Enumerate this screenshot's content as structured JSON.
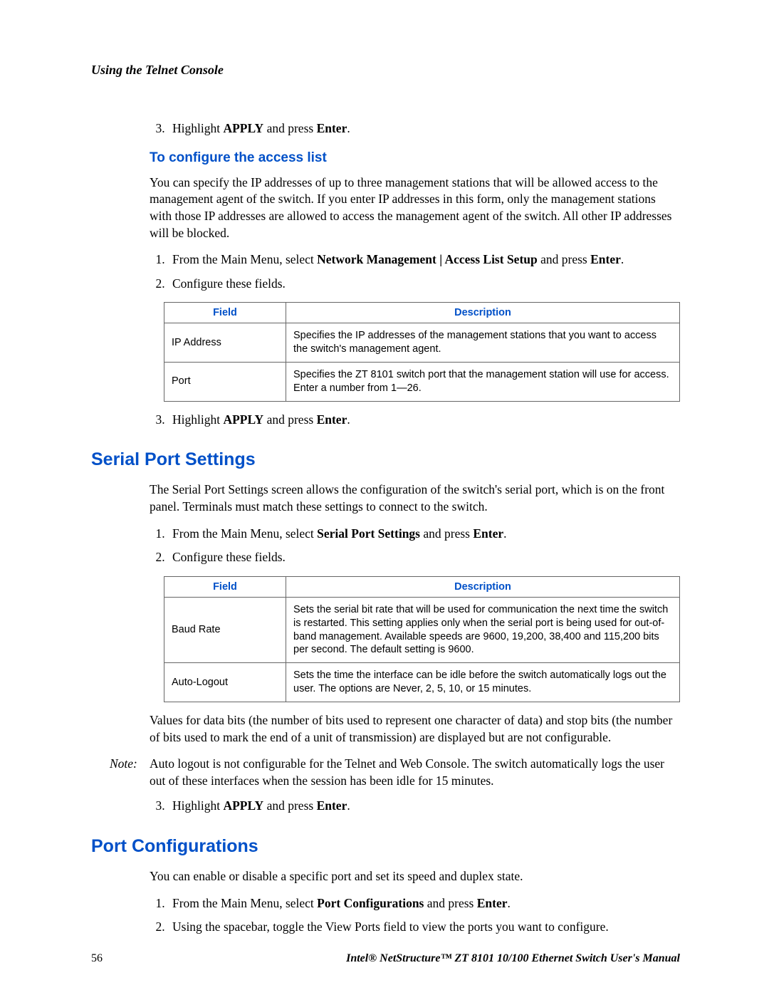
{
  "header": {
    "running": "Using the Telnet Console"
  },
  "intro_step": {
    "number": "3.",
    "prefix": "Highlight ",
    "apply": "APPLY",
    "mid": " and press ",
    "enter": "Enter",
    "suffix": "."
  },
  "access": {
    "heading": "To configure the access list",
    "para": "You can specify the IP addresses of up to three management stations that will be allowed access to the management agent of the switch. If you enter IP addresses in this form, only the management stations with those IP addresses are allowed to access the management agent of the switch. All other IP addresses will be blocked.",
    "step1": {
      "prefix": "From the Main Menu, select ",
      "menu": "Network Management | Access List Setup",
      "mid": " and press ",
      "enter": "Enter",
      "suffix": "."
    },
    "step2": "Configure these fields.",
    "table": {
      "h1": "Field",
      "h2": "Description",
      "r1f": "IP Address",
      "r1d": "Specifies the IP addresses of the management stations that you want to access the switch's management agent.",
      "r2f": "Port",
      "r2d": "Specifies the ZT 8101 switch port that the management station will use for access. Enter a number from 1—26."
    },
    "step3": {
      "prefix": "Highlight ",
      "apply": "APPLY",
      "mid": " and press ",
      "enter": "Enter",
      "suffix": "."
    }
  },
  "serial": {
    "heading": "Serial Port Settings",
    "para": "The Serial Port Settings screen allows the configuration of the switch's serial port, which is on the front panel. Terminals must match these settings to connect to the switch.",
    "step1": {
      "prefix": "From the Main Menu, select ",
      "menu": "Serial Port Settings",
      "mid": " and press ",
      "enter": "Enter",
      "suffix": "."
    },
    "step2": "Configure these fields.",
    "table": {
      "h1": "Field",
      "h2": "Description",
      "r1f": "Baud Rate",
      "r1d": "Sets the serial bit rate that will be used for communication the next time the switch is restarted. This setting applies only when the serial port is being used for out-of-band management. Available speeds are 9600, 19,200, 38,400 and 115,200 bits per second. The default setting is 9600.",
      "r2f": "Auto-Logout",
      "r2d": "Sets the time the interface can be idle before the switch automatically logs out the user. The options are Never, 2, 5, 10, or 15 minutes."
    },
    "values_para": "Values for data bits (the number of bits used to represent one character of data) and stop bits (the number of bits used to mark the end of a unit of transmission) are displayed but are not configurable.",
    "note_label": "Note:",
    "note_text": "Auto logout is not configurable for the Telnet and Web Console. The switch automatically logs the user out of these interfaces when the session has been idle for 15 minutes.",
    "step3": {
      "prefix": "Highlight ",
      "apply": "APPLY",
      "mid": " and press ",
      "enter": "Enter",
      "suffix": "."
    }
  },
  "portconf": {
    "heading": "Port Configurations",
    "para": "You can enable or disable a specific port and set its speed and duplex state.",
    "step1": {
      "prefix": "From the Main Menu, select ",
      "menu": "Port Configurations",
      "mid": " and press ",
      "enter": "Enter",
      "suffix": "."
    },
    "step2": "Using the spacebar, toggle the View Ports field to view the ports you want to configure."
  },
  "footer": {
    "page": "56",
    "manual": "Intel® NetStructure™ ZT 8101 10/100 Ethernet Switch User's Manual"
  }
}
